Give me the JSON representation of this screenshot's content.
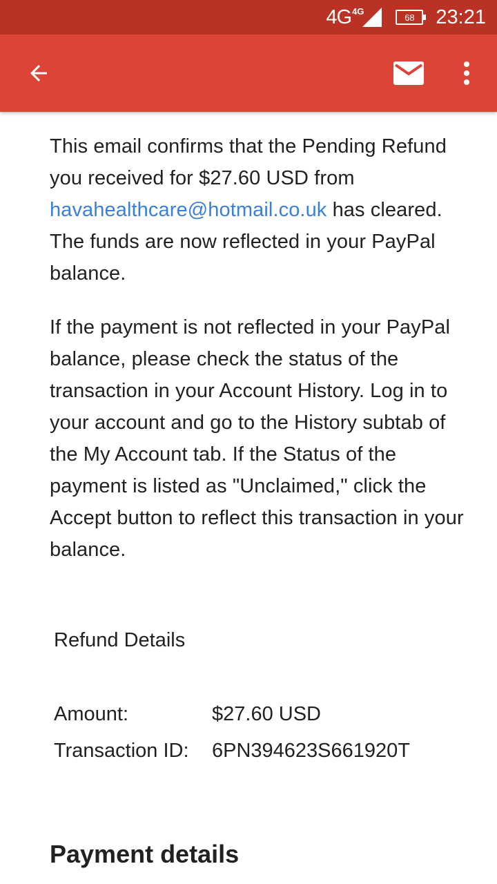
{
  "status_bar": {
    "network_type": "4G",
    "network_sup": "4G",
    "battery": "68",
    "time": "23:21",
    "color": "#b93224"
  },
  "app_bar": {
    "color": "#db4437",
    "back_icon": "arrow-back-icon",
    "mail_icon": "mail-icon",
    "more_icon": "more-vert-icon"
  },
  "email": {
    "para1_before": "This email confirms that the Pending Refund you received for $27.60 USD from ",
    "para1_link": "havahealthcare@hotmail.co.uk",
    "para1_after": " has cleared. The funds are now reflected in your PayPal balance.",
    "para2": "If the payment is not reflected in your PayPal balance, please check the status of the transaction in your Account History. Log in to your account and go to the History subtab of the My Account tab. If the Status of the payment is listed as \"Unclaimed,\" click the Accept button to reflect this transaction in your balance.",
    "refund_details_title": "Refund Details",
    "details": {
      "amount_label": "Amount:",
      "amount_value": "$27.60 USD",
      "transaction_label": "Transaction ID:",
      "transaction_value": "6PN394623S661920T"
    },
    "payment_details_heading": "Payment details"
  }
}
